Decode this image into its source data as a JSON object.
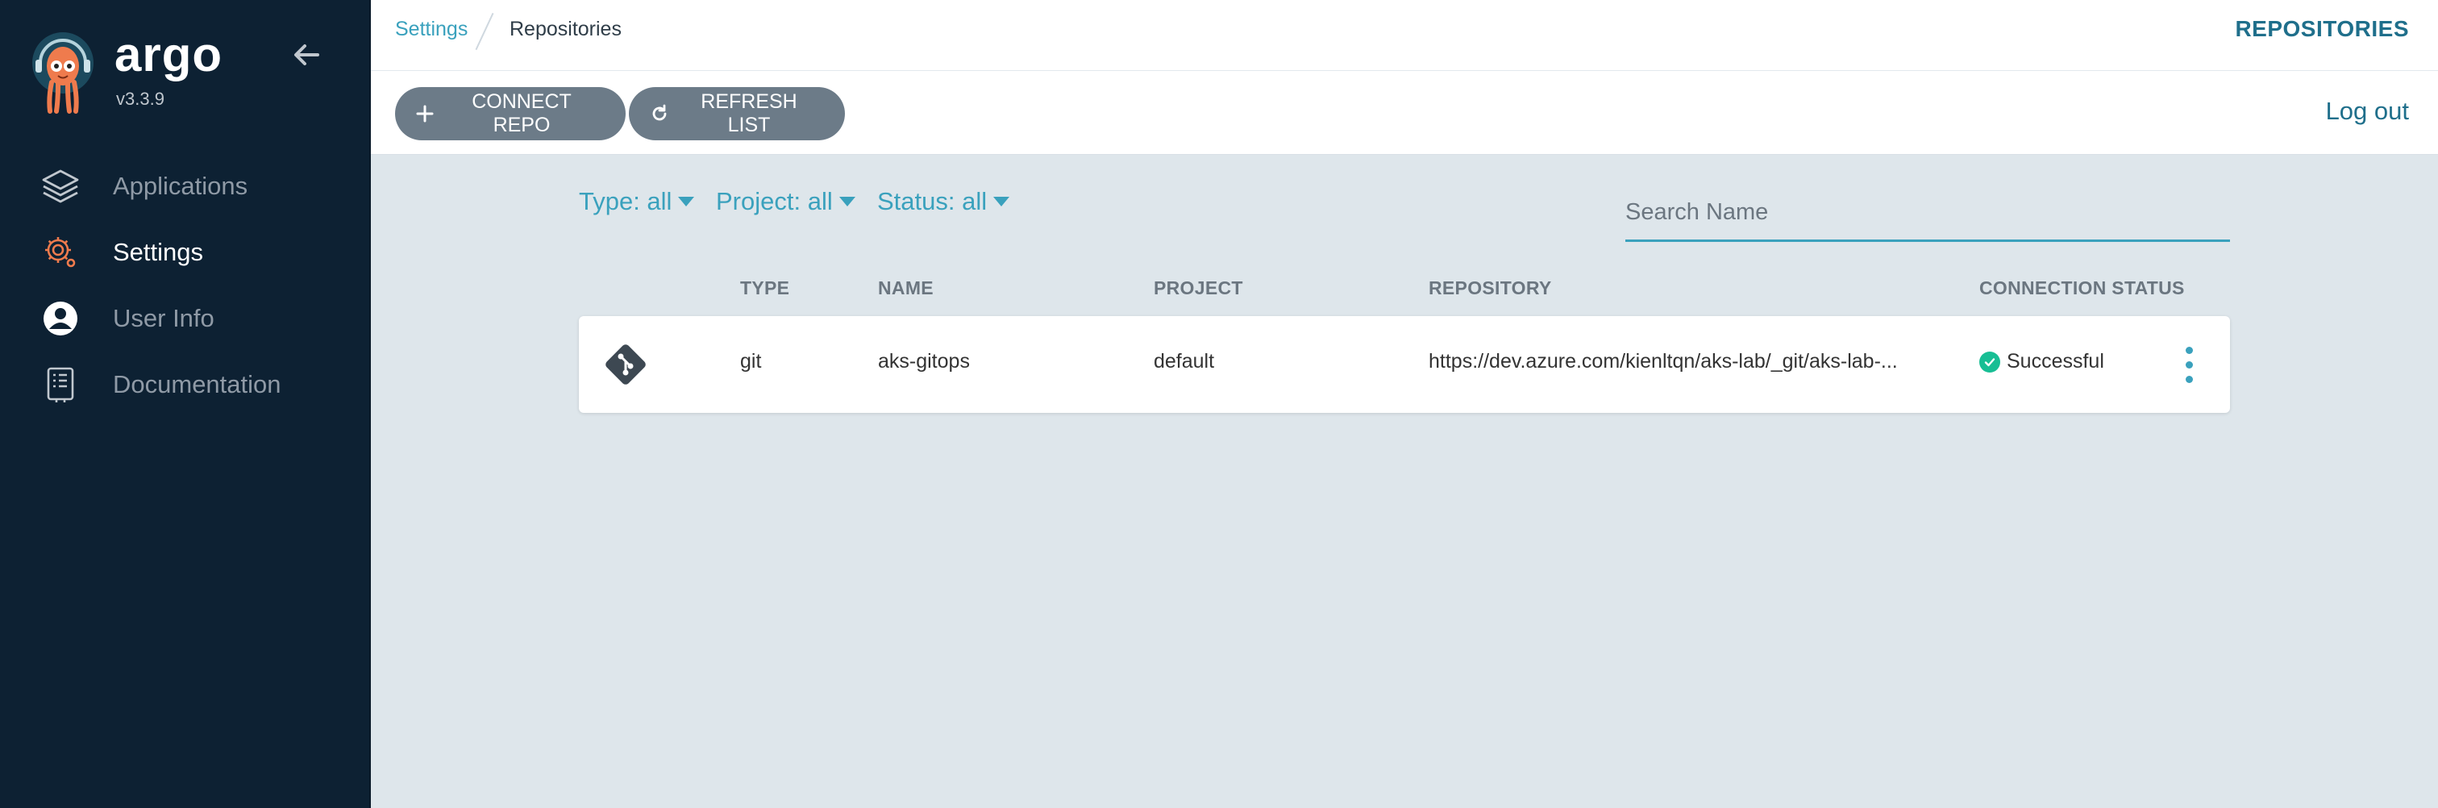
{
  "sidebar": {
    "brand": "argo",
    "version": "v3.3.9",
    "items": [
      {
        "label": "Applications",
        "icon": "layers-icon"
      },
      {
        "label": "Settings",
        "icon": "gear-icon"
      },
      {
        "label": "User Info",
        "icon": "user-icon"
      },
      {
        "label": "Documentation",
        "icon": "book-icon"
      }
    ]
  },
  "topbar": {
    "breadcrumb": [
      "Settings",
      "Repositories"
    ],
    "title": "REPOSITORIES"
  },
  "toolbar": {
    "connect_label": "CONNECT REPO",
    "refresh_label": "REFRESH LIST",
    "logout_label": "Log out"
  },
  "filters": {
    "type": "Type: all",
    "project": "Project: all",
    "status": "Status: all"
  },
  "search": {
    "placeholder": "Search Name",
    "value": ""
  },
  "table": {
    "headers": [
      "TYPE",
      "NAME",
      "PROJECT",
      "REPOSITORY",
      "CONNECTION STATUS"
    ],
    "rows": [
      {
        "type": "git",
        "name": "aks-gitops",
        "project": "default",
        "repository": "https://dev.azure.com/kienltqn/aks-lab/_git/aks-lab-...",
        "status": "Successful"
      }
    ]
  },
  "colors": {
    "sidebar_bg": "#0d2133",
    "accent": "#3aa1bd",
    "title": "#1f6f8b",
    "button": "#6c7b88",
    "success": "#18be94",
    "content_bg": "#dee6eb"
  }
}
